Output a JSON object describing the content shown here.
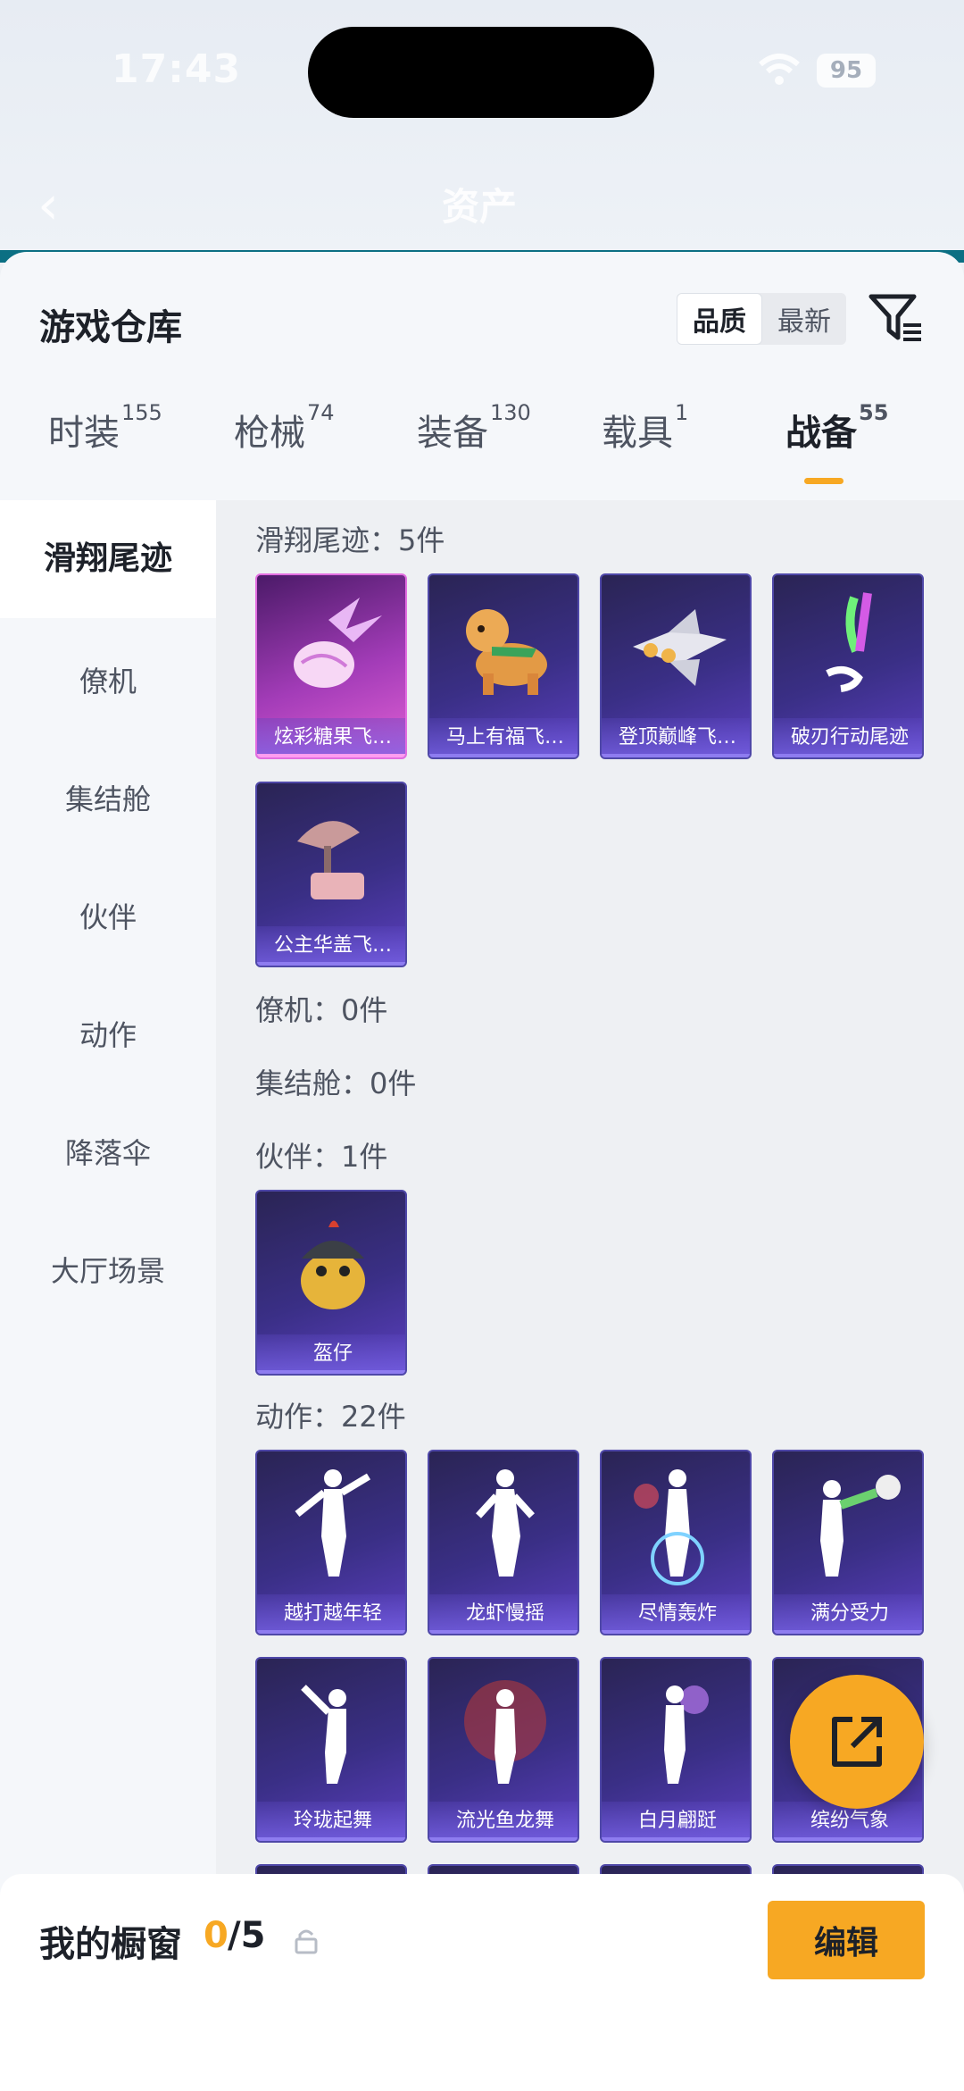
{
  "status_bar": {
    "time": "17:43",
    "battery": "95"
  },
  "background_app": {
    "title": "资产"
  },
  "sheet": {
    "title": "游戏仓库",
    "sort_options": [
      "品质",
      "最新"
    ],
    "tabs": [
      {
        "label": "时装",
        "count": "155"
      },
      {
        "label": "枪械",
        "count": "74"
      },
      {
        "label": "装备",
        "count": "130"
      },
      {
        "label": "载具",
        "count": "1"
      },
      {
        "label": "战备",
        "count": "55"
      }
    ],
    "active_tab": "战备",
    "sidebar": [
      "滑翔尾迹",
      "僚机",
      "集结舱",
      "伙伴",
      "动作",
      "降落伞",
      "大厅场景"
    ],
    "sections": [
      {
        "label": "滑翔尾迹：5件"
      },
      {
        "label": "僚机：0件"
      },
      {
        "label": "集结舱：0件"
      },
      {
        "label": "伙伴：1件"
      },
      {
        "label": "动作：22件"
      }
    ],
    "items": {
      "trail": [
        "炫彩糖果飞…",
        "马上有福飞…",
        "登顶巅峰飞…",
        "破刃行动尾迹",
        "公主华盖飞…"
      ],
      "partner": [
        "盔仔"
      ],
      "emote": [
        "越打越年轻",
        "龙虾慢摇",
        "尽情轰炸",
        "满分受力",
        "玲珑起舞",
        "流光鱼龙舞",
        "白月翩跹",
        "缤纷气象"
      ]
    }
  },
  "bottom_bar": {
    "label": "我的橱窗",
    "count": "0",
    "total": "/5",
    "edit_label": "编辑"
  },
  "colors": {
    "accent": "#f7a823",
    "card_purple": "#3a2f86",
    "card_pink": "#a33cb8"
  }
}
